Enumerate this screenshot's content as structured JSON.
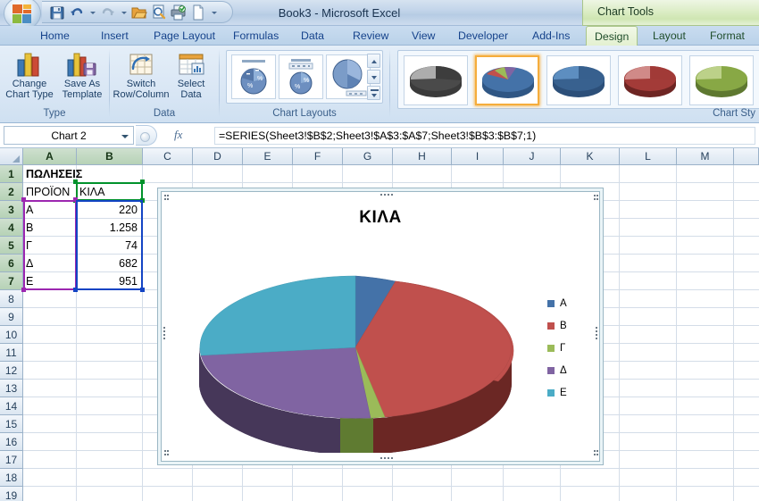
{
  "window": {
    "title": "Book3 - Microsoft Excel",
    "contextual_tab_title": "Chart Tools"
  },
  "quick_access": {
    "items": [
      "save-icon",
      "undo-icon",
      "undo-dropdown-icon",
      "redo-icon",
      "redo-dropdown-icon",
      "open-icon",
      "print-preview-icon",
      "print-icon",
      "new-icon",
      "customize-qat-icon"
    ]
  },
  "tabs": {
    "main": [
      "Home",
      "Insert",
      "Page Layout",
      "Formulas",
      "Data",
      "Review",
      "View",
      "Developer",
      "Add-Ins"
    ],
    "chart_tools": [
      "Design",
      "Layout",
      "Format"
    ],
    "active": "Design"
  },
  "ribbon": {
    "groups": [
      {
        "label": "Type",
        "buttons": [
          {
            "label": "Change\nChart Type",
            "line1": "Change",
            "line2": "Chart Type",
            "icon": "change-chart-type-icon"
          },
          {
            "label": "Save As\nTemplate",
            "line1": "Save As",
            "line2": "Template",
            "icon": "save-as-template-icon"
          }
        ]
      },
      {
        "label": "Data",
        "buttons": [
          {
            "line1": "Switch",
            "line2": "Row/Column",
            "icon": "switch-row-column-icon"
          },
          {
            "line1": "Select",
            "line2": "Data",
            "icon": "select-data-icon"
          }
        ]
      },
      {
        "label": "Chart Layouts",
        "items": [
          "layout-1",
          "layout-2",
          "layout-3"
        ]
      },
      {
        "label": "Chart Sty",
        "items": [
          "style-gray",
          "style-colorful-selected",
          "style-blue",
          "style-red",
          "style-green"
        ]
      }
    ]
  },
  "formula_bar": {
    "name_box": "Chart 2",
    "formula": "=SERIES(Sheet3!$B$2;Sheet3!$A$3:$A$7;Sheet3!$B$3:$B$7;1)",
    "fx_label": "fx"
  },
  "sheet": {
    "column_headers": [
      "A",
      "B",
      "C",
      "D",
      "E",
      "F",
      "G",
      "H",
      "I",
      "J",
      "K",
      "L",
      "M"
    ],
    "row_headers": [
      "1",
      "2",
      "3",
      "4",
      "5",
      "6",
      "7",
      "8",
      "9",
      "10",
      "11",
      "12",
      "13",
      "14",
      "15",
      "16",
      "17",
      "18",
      "19"
    ],
    "cells": [
      {
        "row": 1,
        "col": "A",
        "value": "ΠΩΛΗΣΕΙΣ",
        "bold": true,
        "align": "left"
      },
      {
        "row": 2,
        "col": "A",
        "value": "ΠΡΟΪΟΝ",
        "bold": false,
        "align": "left"
      },
      {
        "row": 2,
        "col": "B",
        "value": "ΚΙΛΑ",
        "bold": false,
        "align": "left"
      },
      {
        "row": 3,
        "col": "A",
        "value": "Α",
        "align": "left"
      },
      {
        "row": 3,
        "col": "B",
        "value": "220",
        "align": "right"
      },
      {
        "row": 4,
        "col": "A",
        "value": "Β",
        "align": "left"
      },
      {
        "row": 4,
        "col": "B",
        "value": "1.258",
        "align": "right"
      },
      {
        "row": 5,
        "col": "A",
        "value": "Γ",
        "align": "left"
      },
      {
        "row": 5,
        "col": "B",
        "value": "74",
        "align": "right"
      },
      {
        "row": 6,
        "col": "A",
        "value": "Δ",
        "align": "left"
      },
      {
        "row": 6,
        "col": "B",
        "value": "682",
        "align": "right"
      },
      {
        "row": 7,
        "col": "A",
        "value": "Ε",
        "align": "left"
      },
      {
        "row": 7,
        "col": "B",
        "value": "951",
        "align": "right"
      }
    ],
    "selection": {
      "series_name_range": "B2",
      "category_range": "A3:A7",
      "value_range": "B3:B7",
      "series_color": "#00922b",
      "category_color": "#9c27b0",
      "value_color": "#1344c4"
    }
  },
  "chart_data": {
    "type": "pie",
    "title": "ΚΙΛΑ",
    "categories": [
      "Α",
      "Β",
      "Γ",
      "Δ",
      "Ε"
    ],
    "values": [
      220,
      1258,
      74,
      682,
      951
    ],
    "colors": [
      "#4472a8",
      "#c0504d",
      "#9bbb59",
      "#8064a2",
      "#4bacc6"
    ],
    "legend_entries": [
      "Α",
      "Β",
      "Γ",
      "Δ",
      "Ε"
    ],
    "legend_position": "right",
    "three_d": true,
    "xlabel": "",
    "ylabel": "",
    "grid": false
  },
  "colors": {
    "accent_blue": "#4472a8",
    "accent_red": "#c0504d",
    "accent_green": "#9bbb59",
    "accent_purple": "#8064a2",
    "accent_teal": "#4bacc6",
    "selection_orange": "#f5ad3c"
  }
}
